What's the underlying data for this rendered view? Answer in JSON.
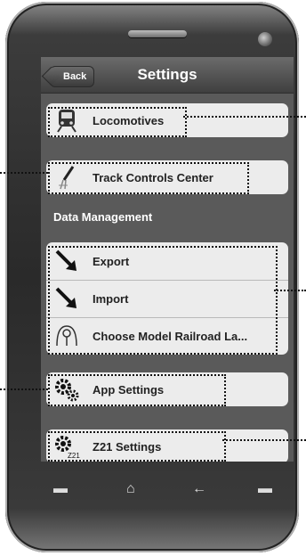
{
  "nav": {
    "back_label": "Back",
    "title": "Settings"
  },
  "items": {
    "locomotives": "Locomotives",
    "track_controls": "Track Controls Center",
    "section_data": "Data Management",
    "export": "Export",
    "import": "Import",
    "choose_layout": "Choose Model Railroad La...",
    "app_settings": "App Settings",
    "z21_settings": "Z21 Settings"
  },
  "icons": {
    "locomotives": "train-icon",
    "track_controls": "track-icon",
    "export": "export-arrow-icon",
    "import": "import-arrow-icon",
    "choose_layout": "layout-icon",
    "app_settings": "gears-icon",
    "z21_settings": "z21-gear-icon"
  },
  "colors": {
    "screen_bg": "#5a5a5a",
    "cell_bg": "#ececec",
    "navbar": "#4a4a4a"
  }
}
